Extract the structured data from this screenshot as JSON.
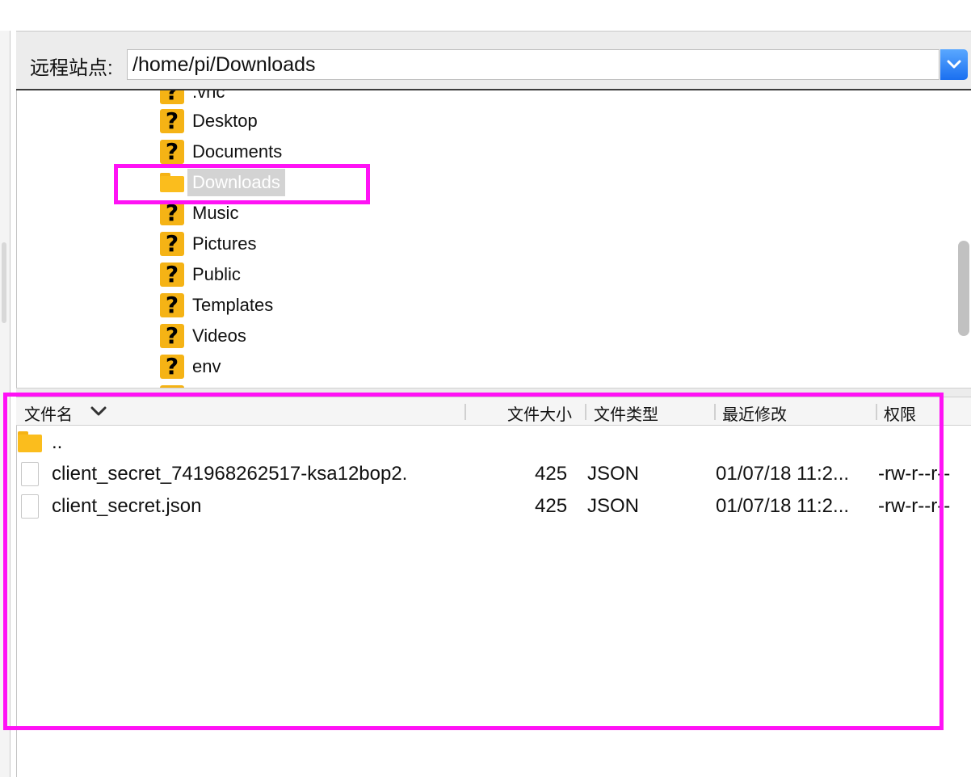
{
  "remote_site": {
    "label": "远程站点:",
    "path": "/home/pi/Downloads"
  },
  "tree": {
    "items": [
      {
        "label": ".vnc",
        "icon": "question-folder-icon"
      },
      {
        "label": "Desktop",
        "icon": "question-folder-icon"
      },
      {
        "label": "Documents",
        "icon": "question-folder-icon"
      },
      {
        "label": "Downloads",
        "icon": "folder-icon",
        "selected": true
      },
      {
        "label": "Music",
        "icon": "question-folder-icon"
      },
      {
        "label": "Pictures",
        "icon": "question-folder-icon"
      },
      {
        "label": "Public",
        "icon": "question-folder-icon"
      },
      {
        "label": "Templates",
        "icon": "question-folder-icon"
      },
      {
        "label": "Videos",
        "icon": "question-folder-icon"
      },
      {
        "label": "env",
        "icon": "question-folder-icon"
      }
    ]
  },
  "file_list": {
    "columns": {
      "name": "文件名",
      "size": "文件大小",
      "type": "文件类型",
      "modified": "最近修改",
      "perms": "权限"
    },
    "rows": [
      {
        "name": "..",
        "size": "",
        "type": "",
        "modified": "",
        "perms": "",
        "icon": "folder-icon"
      },
      {
        "name": "client_secret_741968262517-ksa12bop2.",
        "size": "425",
        "type": "JSON",
        "modified": "01/07/18 11:2...",
        "perms": "-rw-r--r--",
        "icon": "file-icon"
      },
      {
        "name": "client_secret.json",
        "size": "425",
        "type": "JSON",
        "modified": "01/07/18 11:2...",
        "perms": "-rw-r--r--",
        "icon": "file-icon"
      }
    ]
  },
  "colors": {
    "highlight": "#ff12f5",
    "folder": "#fbbd1d",
    "dropdown_accent": "#1a6ff0"
  }
}
